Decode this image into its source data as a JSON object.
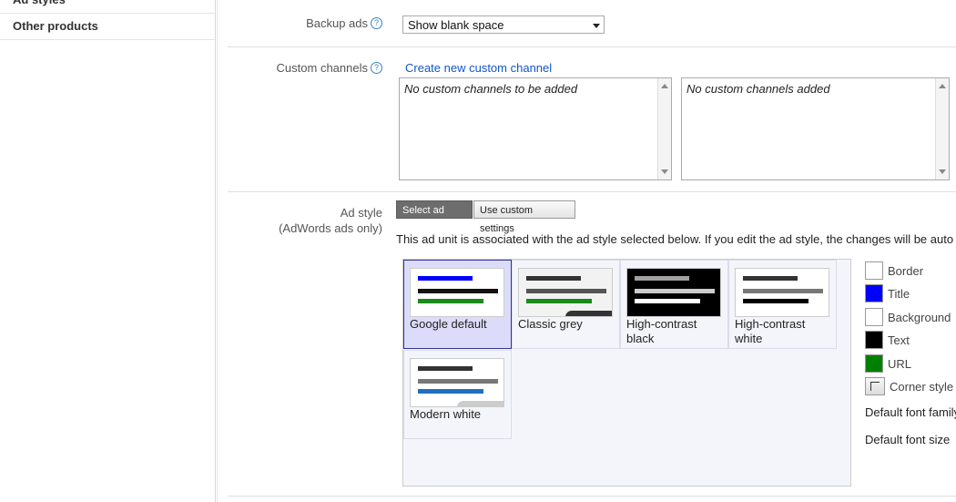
{
  "sidebar": {
    "items": [
      {
        "label": "Ad styles"
      },
      {
        "label": "Other products"
      }
    ]
  },
  "backup_ads": {
    "label": "Backup ads",
    "selected": "Show blank space"
  },
  "custom_channels": {
    "label": "Custom channels",
    "create_link": "Create new custom channel",
    "available_text": "No custom channels to be added",
    "added_text": "No custom channels added"
  },
  "ad_style": {
    "label": "Ad style",
    "sublabel": "(AdWords ads only)",
    "btn_select": "Select ad style",
    "btn_custom": "Use custom settings",
    "info": "This ad unit is associated with the ad style selected below. If you edit the ad style, the changes will be auto",
    "styles": [
      {
        "name": "Google default",
        "bg": "#ffffff",
        "b1": "#0000ff",
        "b2": "#111111",
        "b3": "#1a8a1a",
        "corner": ""
      },
      {
        "name": "Classic grey",
        "bg": "#f2f2f2",
        "b1": "#333333",
        "b2": "#555555",
        "b3": "#1a8a1a",
        "corner": "#333333"
      },
      {
        "name": "High-contrast black",
        "bg": "#000000",
        "b1": "#a0a0a0",
        "b2": "#cccccc",
        "b3": "#ffffff",
        "corner": ""
      },
      {
        "name": "High-contrast white",
        "bg": "#ffffff",
        "b1": "#333333",
        "b2": "#777777",
        "b3": "#000000",
        "corner": ""
      },
      {
        "name": "Modern white",
        "bg": "#ffffff",
        "b1": "#333333",
        "b2": "#777777",
        "b3": "#1f6fbf",
        "corner": "#cccccc"
      }
    ],
    "swatches": [
      {
        "label": "Border",
        "color": "#ffffff"
      },
      {
        "label": "Title",
        "color": "#0000ff"
      },
      {
        "label": "Background",
        "color": "#ffffff"
      },
      {
        "label": "Text",
        "color": "#000000"
      },
      {
        "label": "URL",
        "color": "#008000"
      }
    ],
    "corner_style_label": "Corner style",
    "default_font_family": "Default font family",
    "default_font_size": "Default font size"
  },
  "colors": {
    "link": "#1155cc",
    "selected_tile_bg": "#dcdcfa",
    "selected_tile_border": "#33338f"
  }
}
